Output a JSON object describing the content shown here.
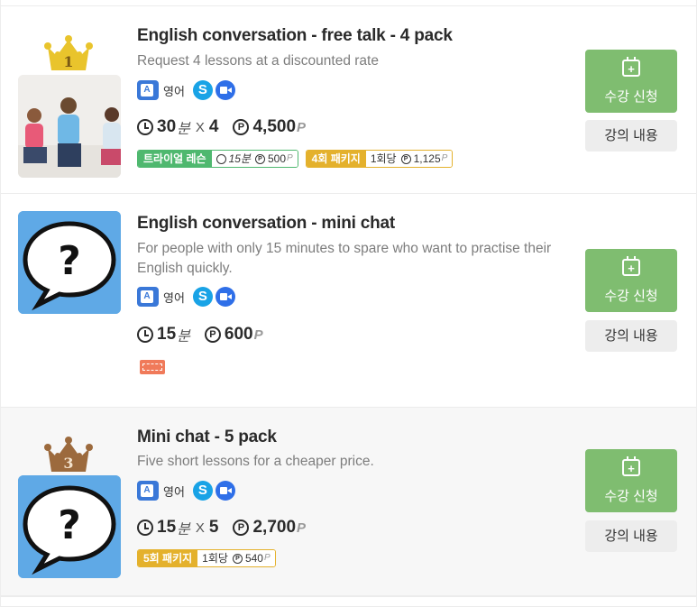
{
  "courses": [
    {
      "rank": "1",
      "title": "English conversation - free talk - 4 pack",
      "description": "Request 4 lessons at a discounted rate",
      "language": "영어",
      "lang_badge": "A",
      "duration": "30",
      "duration_unit": "분",
      "multiplier": "X",
      "count": "4",
      "coin_symbol": "P",
      "price": "4,500",
      "price_unit": "P",
      "trial_label": "트라이얼 레슨",
      "trial_duration": "15분",
      "trial_price": "500",
      "trial_unit": "P",
      "package_label": "4회 패키지",
      "package_per": "1회당",
      "package_price": "1,125",
      "package_unit": "P",
      "apply_label": "수강 신청",
      "detail_label": "강의 내용"
    },
    {
      "title": "English conversation - mini chat",
      "description": "For people with only 15 minutes to spare who want to practise their English quickly.",
      "language": "영어",
      "lang_badge": "A",
      "duration": "15",
      "duration_unit": "분",
      "coin_symbol": "P",
      "price": "600",
      "price_unit": "P",
      "apply_label": "수강 신청",
      "detail_label": "강의 내용"
    },
    {
      "rank": "3",
      "title": "Mini chat - 5 pack",
      "description": "Five short lessons for a cheaper price.",
      "language": "영어",
      "lang_badge": "A",
      "duration": "15",
      "duration_unit": "분",
      "multiplier": "X",
      "count": "5",
      "coin_symbol": "P",
      "price": "2,700",
      "price_unit": "P",
      "package_label": "5회 패키지",
      "package_per": "1회당",
      "package_price": "540",
      "package_unit": "P",
      "apply_label": "수강 신청",
      "detail_label": "강의 내용"
    }
  ],
  "icons": {
    "skype": "S",
    "calendar_plus": "+"
  },
  "colors": {
    "apply_button": "#7fbd70",
    "trial_tag": "#4fb86f",
    "package_tag": "#e4b12c",
    "gold_crown": "#e9c42c",
    "bronze_crown": "#9c6a3d",
    "skype": "#19a3e6",
    "zoom": "#2f6fe8"
  }
}
